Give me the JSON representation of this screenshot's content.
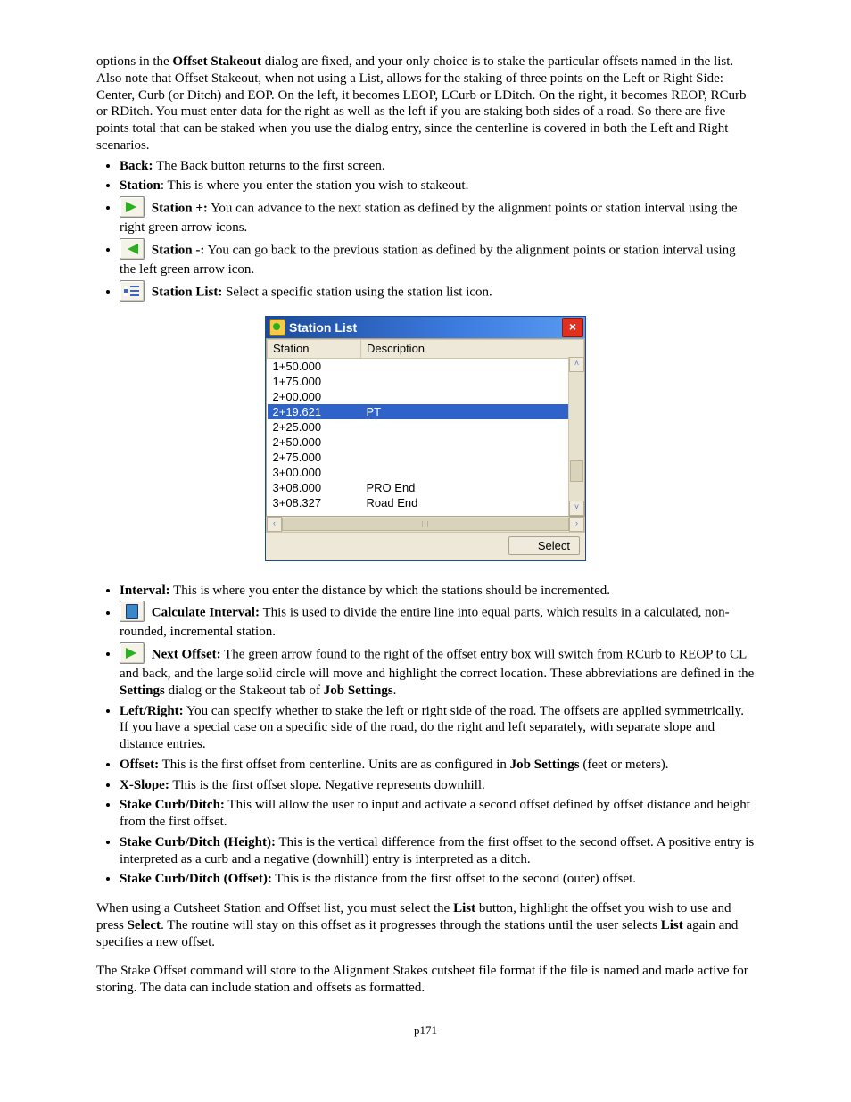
{
  "intro": {
    "p1_a": "options in the ",
    "p1_b": "Offset Stakeout",
    "p1_c": " dialog are fixed, and your only choice is to stake the particular offsets named in the list.  Also note that Offset Stakeout, when not using a List, allows for the staking of three points on the Left or Right Side:  Center, Curb (or Ditch) and EOP.  On the left, it becomes LEOP, LCurb or LDitch.  On the right, it becomes REOP, RCurb or RDitch.  You must enter data for the right as well as the left if you are staking both sides of a road.  So there are five points total that can be staked when you use the dialog entry, since the centerline is covered in both the Left and Right scenarios."
  },
  "top_list": {
    "back_label": "Back:",
    "back_text": " The Back button returns to the first screen.",
    "station_label": "Station",
    "station_text": ": This is where you enter the station you wish to stakeout.",
    "station_plus_label": "Station +:",
    "station_plus_text": " You can advance to the next station as defined by the alignment points or station interval using the right green arrow icons.",
    "station_minus_label": "Station -:",
    "station_minus_text": " You can go back to the previous station as defined by the alignment points or station interval using the  left green arrow icon.",
    "station_list_label": "Station List:",
    "station_list_text": " Select a specific station using the station list icon."
  },
  "dialog": {
    "title": "Station List",
    "close": "×",
    "cols": {
      "station": "Station",
      "description": "Description"
    },
    "rows": [
      {
        "station": "1+50.000",
        "desc": ""
      },
      {
        "station": "1+75.000",
        "desc": ""
      },
      {
        "station": "2+00.000",
        "desc": ""
      },
      {
        "station": "2+19.621",
        "desc": "PT",
        "selected": true
      },
      {
        "station": "2+25.000",
        "desc": ""
      },
      {
        "station": "2+50.000",
        "desc": ""
      },
      {
        "station": "2+75.000",
        "desc": ""
      },
      {
        "station": "3+00.000",
        "desc": ""
      },
      {
        "station": "3+08.000",
        "desc": "PRO End"
      },
      {
        "station": "3+08.327",
        "desc": "Road End"
      }
    ],
    "select": "Select"
  },
  "bottom_list": {
    "interval_label": "Interval:",
    "interval_text": " This is where you enter the distance by which the stations should be incremented.",
    "calc_label": "Calculate Interval:",
    "calc_text": " This is used to divide the entire line into equal parts, which results in a calculated, non-rounded, incremental station.",
    "next_label": "Next Offset:",
    "next_a": " The green arrow found to the right of the offset entry box will switch from RCurb to REOP to CL and back, and the large solid circle will move and highlight the correct location. These abbreviations are defined in the ",
    "next_b": "Settings",
    "next_c": " dialog or the Stakeout tab of ",
    "next_d": "Job Settings",
    "next_e": ".",
    "lr_label": "Left/Right:",
    "lr_text": " You can specify whether to stake the left or right side of the road.  The offsets are applied symmetrically.  If you have a special case on a specific side of the road, do the right and left separately, with separate slope and distance entries.",
    "offset_label": "Offset:",
    "offset_a": " This is the first offset from centerline.  Units are as configured in ",
    "offset_b": "Job Settings",
    "offset_c": " (feet or meters).",
    "xslope_label": "X-Slope:",
    "xslope_text": " This is the first offset slope.  Negative represents downhill.",
    "scd_label": "Stake Curb/Ditch:",
    "scd_text": " This will allow the user to input and activate a second offset defined by offset distance and height from the first offset.",
    "scdh_label": "Stake Curb/Ditch (Height):",
    "scdh_text": " This is the vertical difference from the first offset to the second offset.  A positive entry is interpreted as a curb and a negative (downhill) entry is interpreted as a ditch.",
    "scdo_label": "Stake Curb/Ditch (Offset):",
    "scdo_text": " This is the distance from the first offset to the second (outer) offset."
  },
  "trailing": {
    "p1_a": "When using a Cutsheet Station and Offset list, you must select the ",
    "p1_b": "List",
    "p1_c": " button, highlight the offset  you wish to use and press ",
    "p1_d": "Select",
    "p1_e": ".  The routine will stay on this offset as it progresses through the stations until the user selects ",
    "p1_f": "List",
    "p1_g": " again and specifies a new offset.",
    "p2": "The Stake Offset command will store to the Alignment Stakes cutsheet file format if the file is named and made active for storing.  The data can include station and offsets as formatted."
  },
  "page_number": "p171"
}
